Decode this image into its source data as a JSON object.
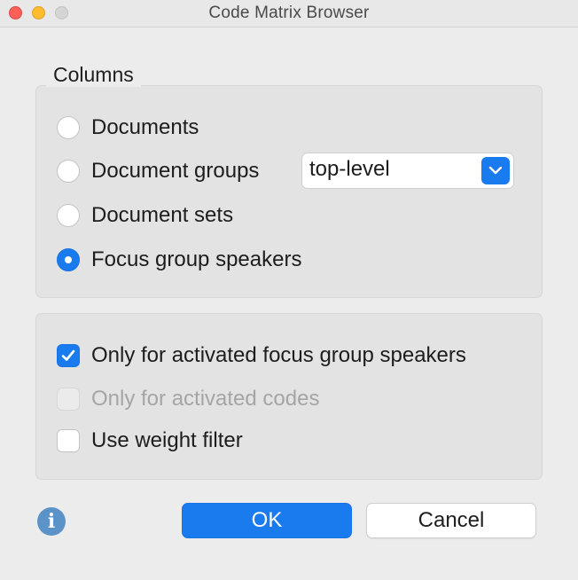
{
  "window": {
    "title": "Code Matrix Browser"
  },
  "columns": {
    "title": "Columns",
    "options": [
      {
        "label": "Documents",
        "checked": false
      },
      {
        "label": "Document groups",
        "checked": false
      },
      {
        "label": "Document sets",
        "checked": false
      },
      {
        "label": "Focus group speakers",
        "checked": true
      }
    ],
    "groups_select": {
      "value": "top-level"
    }
  },
  "options": {
    "items": [
      {
        "label": "Only for activated focus group speakers",
        "checked": true,
        "disabled": false
      },
      {
        "label": "Only for activated codes",
        "checked": false,
        "disabled": true
      },
      {
        "label": "Use weight filter",
        "checked": false,
        "disabled": false
      }
    ]
  },
  "buttons": {
    "ok": "OK",
    "cancel": "Cancel"
  },
  "icons": {
    "info": "i"
  },
  "colors": {
    "accent": "#1a7bef",
    "info": "#5b93c9"
  }
}
